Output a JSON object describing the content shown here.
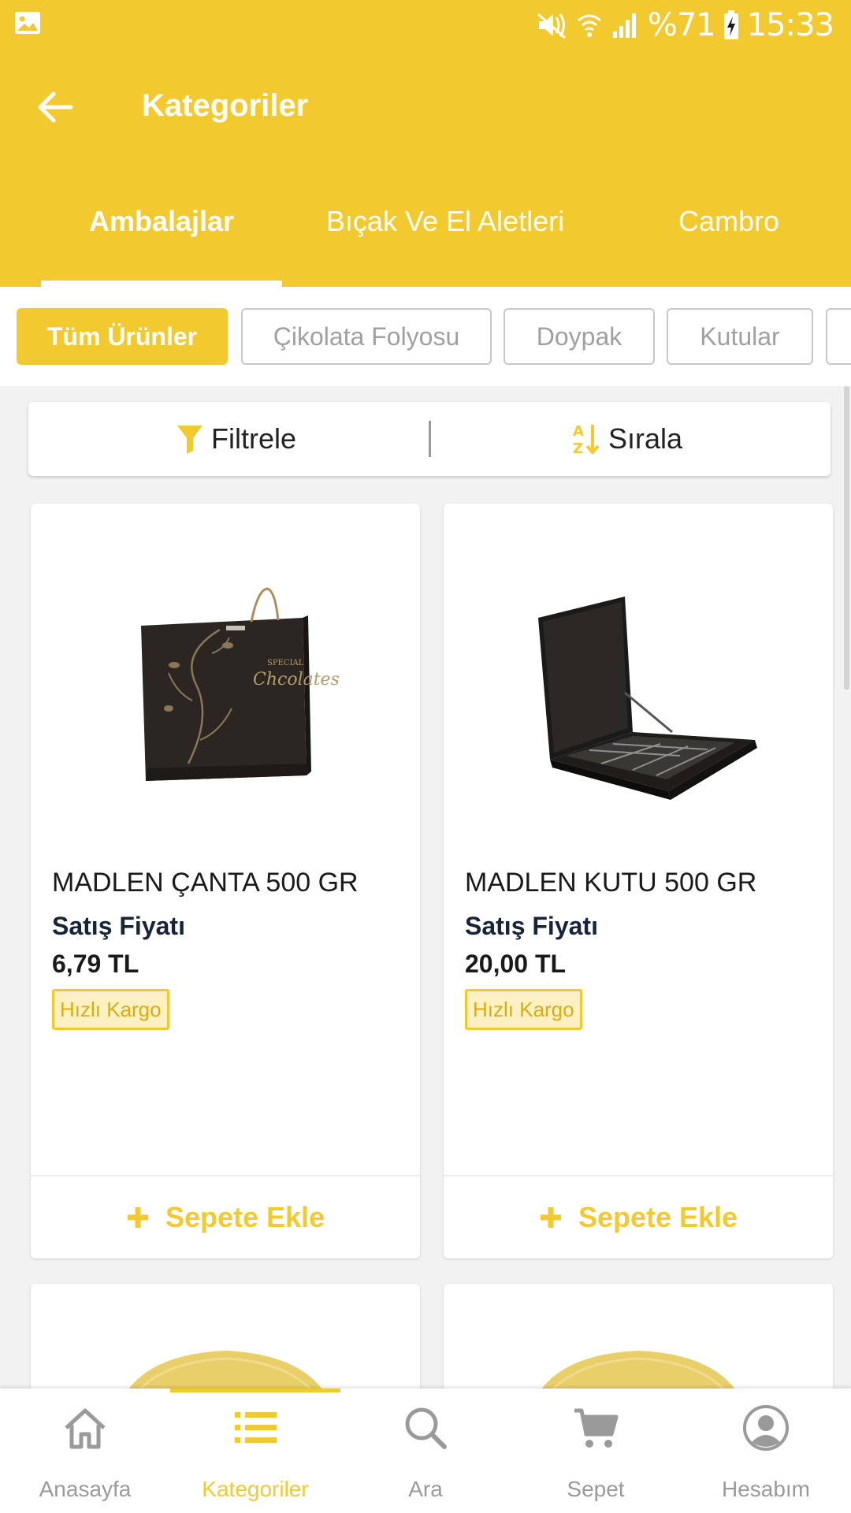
{
  "status_bar": {
    "battery": "%71",
    "time": "15:33"
  },
  "app_bar": {
    "title": "Kategoriler"
  },
  "category_tabs": [
    {
      "label": "Ambalajlar",
      "active": true
    },
    {
      "label": "Bıçak Ve El Aletleri",
      "active": false
    },
    {
      "label": "Cambro",
      "active": false
    }
  ],
  "subcategory_chips": [
    {
      "label": "Tüm Ürünler",
      "active": true
    },
    {
      "label": "Çikolata Folyosu",
      "active": false
    },
    {
      "label": "Doypak",
      "active": false
    },
    {
      "label": "Kutular",
      "active": false
    }
  ],
  "toolbar": {
    "filter_label": "Filtrele",
    "sort_label": "Sırala"
  },
  "products": [
    {
      "name": "MADLEN ÇANTA 500 GR",
      "price_label": "Satış Fiyatı",
      "price": "6,79 TL",
      "badge": "Hızlı Kargo",
      "add_label": "Sepete Ekle",
      "image": "gift-bag"
    },
    {
      "name": "MADLEN KUTU 500 GR",
      "price_label": "Satış Fiyatı",
      "price": "20,00 TL",
      "badge": "Hızlı Kargo",
      "add_label": "Sepete Ekle",
      "image": "gift-box"
    }
  ],
  "bottom_nav": [
    {
      "label": "Anasayfa",
      "icon": "home-icon",
      "active": false
    },
    {
      "label": "Kategoriler",
      "icon": "list-icon",
      "active": true
    },
    {
      "label": "Ara",
      "icon": "search-icon",
      "active": false
    },
    {
      "label": "Sepet",
      "icon": "cart-icon",
      "active": false
    },
    {
      "label": "Hesabım",
      "icon": "account-icon",
      "active": false
    }
  ],
  "colors": {
    "accent": "#f2ca30",
    "price_label": "#16243a",
    "inactive": "#9a9a9a"
  }
}
